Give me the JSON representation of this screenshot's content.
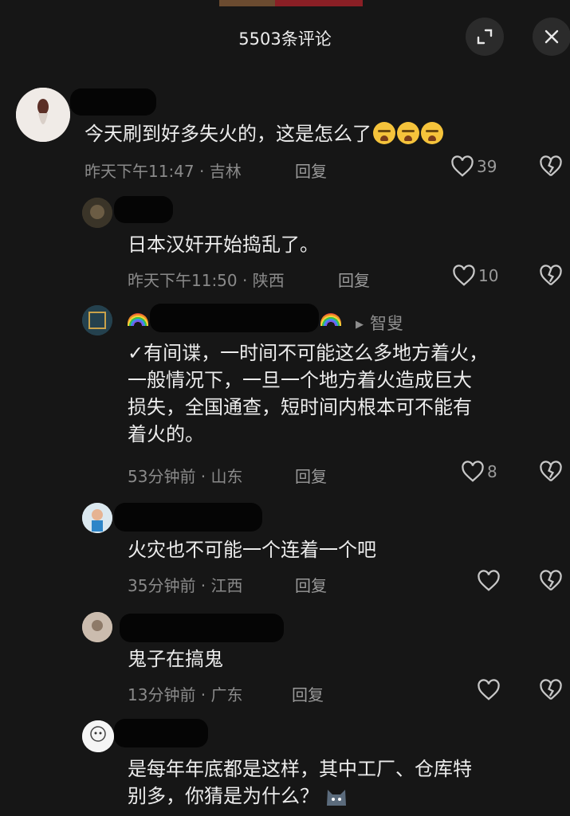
{
  "header": {
    "title": "5503条评论",
    "expand_icon": "expand-icon",
    "close_icon": "close-icon"
  },
  "comments": [
    {
      "text": "今天刷到好多失火的，这是怎么了",
      "emojis": [
        "crying-face",
        "crying-face",
        "crying-face"
      ],
      "time_location": "昨天下午11:47 · 吉林",
      "reply": "回复",
      "likes": "39"
    },
    {
      "text": "日本汉奸开始捣乱了。",
      "time_location": "昨天下午11:50 · 陕西",
      "reply": "回复",
      "likes": "10"
    },
    {
      "tag": "智叟",
      "lines": [
        "✓有间谍，一时间不可能这么多地方着火，",
        "一般情况下，一旦一个地方着火造成巨大",
        "损失，全国通查，短时间内根本可不能有",
        "着火的。"
      ],
      "time_location": "53分钟前 · 山东",
      "reply": "回复",
      "likes": "8"
    },
    {
      "text": "火灾也不可能一个连着一个吧",
      "time_location": "35分钟前 · 江西",
      "reply": "回复",
      "likes": ""
    },
    {
      "text": "鬼子在搞鬼",
      "time_location": "13分钟前 · 广东",
      "reply": "回复",
      "likes": ""
    },
    {
      "lines": [
        "是每年年底都是这样，其中工厂、仓库特",
        "别多，你猜是为什么？"
      ]
    }
  ],
  "colors": {
    "background": "#161616",
    "text": "#ececec",
    "meta": "#8a8a8a"
  }
}
